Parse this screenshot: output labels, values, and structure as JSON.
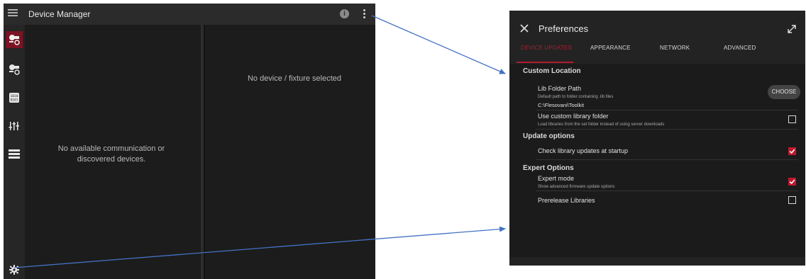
{
  "device_manager": {
    "title": "Device Manager",
    "empty_left_line1": "No available communication or",
    "empty_left_line2": "discovered devices.",
    "empty_right": "No device / fixture selected",
    "info_icon_glyph": "i",
    "sidebar_icons": [
      "fixture-settings-icon",
      "fixture-icon",
      "binary-icon",
      "sliders-icon",
      "stack-icon",
      "gear-icon"
    ]
  },
  "preferences": {
    "title": "Preferences",
    "tabs": [
      "DEVICE UPDATES",
      "APPEARANCE",
      "NETWORK",
      "ADVANCED"
    ],
    "active_tab": "DEVICE UPDATES",
    "sections": {
      "custom_location": {
        "title": "Custom Location",
        "lib_folder_path": {
          "title": "Lib Folder Path",
          "subtitle": "Default path to folder containing .lib files",
          "value": "C:\\Flesovani\\Toolkit",
          "button": "CHOOSE"
        },
        "custom_library_folder": {
          "title": "Use custom library folder",
          "subtitle": "Load libraries from the set folder instead of using server downloads",
          "checked": false
        }
      },
      "update_options": {
        "title": "Update options",
        "check_updates": {
          "title": "Check library updates at startup",
          "checked": true
        }
      },
      "expert_options": {
        "title": "Expert Options",
        "expert_mode": {
          "title": "Expert mode",
          "subtitle": "Show advanced firmware update options",
          "checked": true
        },
        "prerelease": {
          "title": "Prerelease Libraries",
          "checked": false
        }
      }
    }
  },
  "colors": {
    "accent": "#b01b2e",
    "checkbox_on": "#c1172e",
    "arrow": "#4472c4"
  }
}
